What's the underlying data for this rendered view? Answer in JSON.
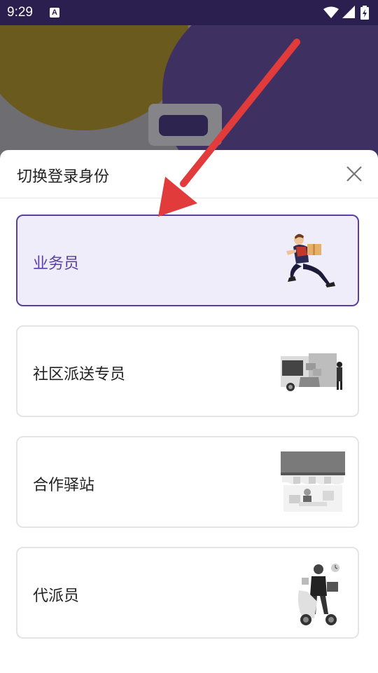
{
  "status_bar": {
    "time": "9:29",
    "notification_icon": "A"
  },
  "dialog": {
    "title": "切换登录身份",
    "options": [
      {
        "label": "业务员",
        "selected": true,
        "icon": "courier-running-icon"
      },
      {
        "label": "社区派送专员",
        "selected": false,
        "icon": "delivery-truck-icon"
      },
      {
        "label": "合作驿站",
        "selected": false,
        "icon": "station-storefront-icon"
      },
      {
        "label": "代派员",
        "selected": false,
        "icon": "scooter-courier-icon"
      }
    ]
  },
  "colors": {
    "status_bar": "#2a1f4e",
    "accent": "#5a3ea6",
    "selected_bg": "#efedf9",
    "annotation_arrow": "#e23b3b"
  }
}
